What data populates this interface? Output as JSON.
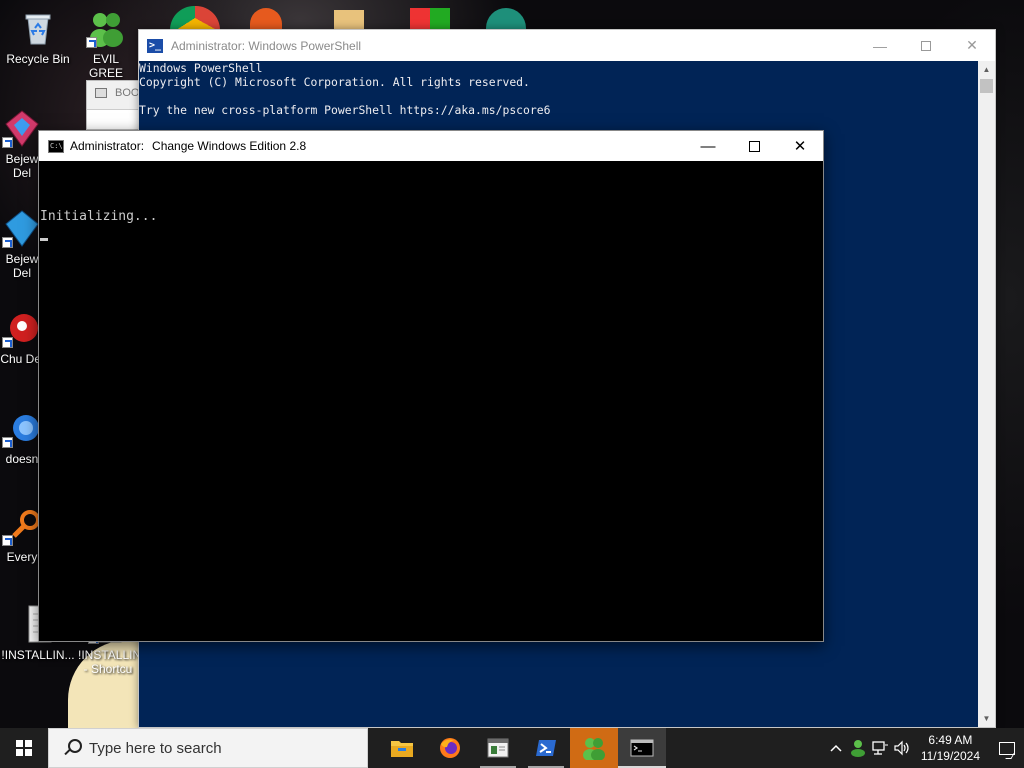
{
  "desktop": {
    "icons": [
      {
        "label": "Recycle Bin",
        "icon": "recycle-bin-icon"
      },
      {
        "label": "EVIL GREE",
        "icon": "evil-green-men-icon"
      },
      {
        "label": "Bejew Del",
        "icon": "bejeweled-icon"
      },
      {
        "label": "Bejew Del",
        "icon": "bejeweled-2-icon"
      },
      {
        "label": "Chu Del",
        "icon": "chuzzle-icon"
      },
      {
        "label": "doesn",
        "icon": "app-icon"
      },
      {
        "label": "Every",
        "icon": "everything-icon"
      },
      {
        "label": "!INSTALLIN...",
        "icon": "document-icon"
      },
      {
        "label": "!INSTALLIN - Shortcu",
        "icon": "document-shortcut-icon"
      }
    ],
    "boot_window_title": "BOO"
  },
  "powershell": {
    "title": "Administrator: Windows PowerShell",
    "lines": [
      "Windows PowerShell",
      "Copyright (C) Microsoft Corporation. All rights reserved.",
      "",
      "Try the new cross-platform PowerShell https://aka.ms/pscore6"
    ]
  },
  "cwe": {
    "title_prefix": "Administrator:",
    "title_app": "Change Windows Edition 2.8",
    "output": "Initializing..."
  },
  "taskbar": {
    "search_placeholder": "Type here to search",
    "apps": [
      {
        "name": "file-explorer-icon"
      },
      {
        "name": "firefox-icon"
      },
      {
        "name": "app-window-icon"
      },
      {
        "name": "powershell-icon"
      },
      {
        "name": "evil-green-men-icon"
      },
      {
        "name": "command-prompt-icon"
      }
    ],
    "time": "6:49 AM",
    "date": "11/19/2024"
  },
  "colors": {
    "powershell_bg": "#012456",
    "console_bg": "#000000",
    "taskbar_bg": "#1f1f1f",
    "active_app": "#d06b14"
  }
}
